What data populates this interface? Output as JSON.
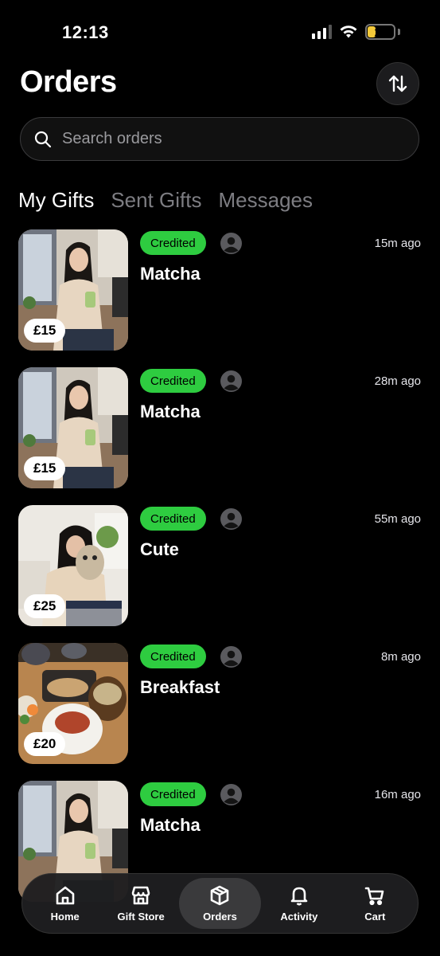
{
  "status_bar": {
    "time": "12:13",
    "battery": "13"
  },
  "header": {
    "title": "Orders",
    "sort_icon": "sort-arrows-icon"
  },
  "search": {
    "placeholder": "Search orders"
  },
  "tabs": [
    {
      "label": "My Gifts",
      "active": true
    },
    {
      "label": "Sent Gifts",
      "active": false
    },
    {
      "label": "Messages",
      "active": false
    }
  ],
  "orders": [
    {
      "price": "£15",
      "status": "Credited",
      "name": "Matcha",
      "time": "15m ago",
      "image": "woman-with-matcha-drink"
    },
    {
      "price": "£15",
      "status": "Credited",
      "name": "Matcha",
      "time": "28m ago",
      "image": "woman-with-matcha-drink"
    },
    {
      "price": "£25",
      "status": "Credited",
      "name": "Cute",
      "time": "55m ago",
      "image": "woman-hugging-plush-toy"
    },
    {
      "price": "£20",
      "status": "Credited",
      "name": "Breakfast",
      "time": "8m ago",
      "image": "japanese-breakfast-tray"
    },
    {
      "price": "",
      "status": "Credited",
      "name": "Matcha",
      "time": "16m ago",
      "image": "woman-with-matcha-drink"
    }
  ],
  "bottom_nav": [
    {
      "label": "Home",
      "icon": "home-icon",
      "active": false
    },
    {
      "label": "Gift Store",
      "icon": "store-icon",
      "active": false
    },
    {
      "label": "Orders",
      "icon": "box-icon",
      "active": true
    },
    {
      "label": "Activity",
      "icon": "bell-icon",
      "active": false
    },
    {
      "label": "Cart",
      "icon": "cart-icon",
      "active": false
    }
  ],
  "colors": {
    "background": "#000000",
    "status_green": "#2ecc40",
    "battery_yellow": "#f3c93a"
  }
}
